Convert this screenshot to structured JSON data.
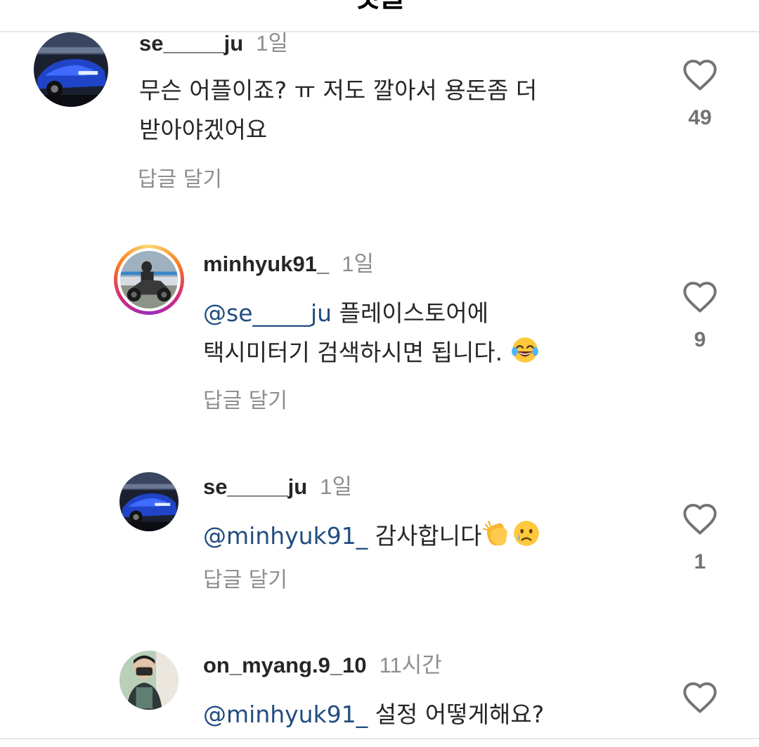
{
  "header": {
    "title": "댓글"
  },
  "comments": [
    {
      "username": "se_____ju",
      "timestamp": "1일",
      "text_line1": "무슨 어플이죠? ㅠ 저도 깔아서 용돈좀 더",
      "text_line2": "받아야겠어요",
      "reply_label": "답글 달기",
      "likes": "49"
    },
    {
      "username": "minhyuk91_",
      "timestamp": "1일",
      "mention": "@se_____ju",
      "text_line1": " 플레이스토어에",
      "text_line2": "택시미터기 검색하시면 됩니다.",
      "emoji": "face-with-tears-of-joy",
      "reply_label": "답글 달기",
      "likes": "9"
    },
    {
      "username": "se_____ju",
      "timestamp": "1일",
      "mention": "@minhyuk91_",
      "text_line1": " 감사합니다",
      "emojis": [
        "clapping-hands",
        "crying-face"
      ],
      "reply_label": "답글 달기",
      "likes": "1"
    },
    {
      "username": "on_myang.9_10",
      "timestamp": "11시간",
      "mention": "@minhyuk91_",
      "text_line1": " 설정 어떻게해요?"
    }
  ],
  "colors": {
    "mention": "#224d7f",
    "secondary_text": "#8e8e8e",
    "primary_text": "#262626"
  }
}
